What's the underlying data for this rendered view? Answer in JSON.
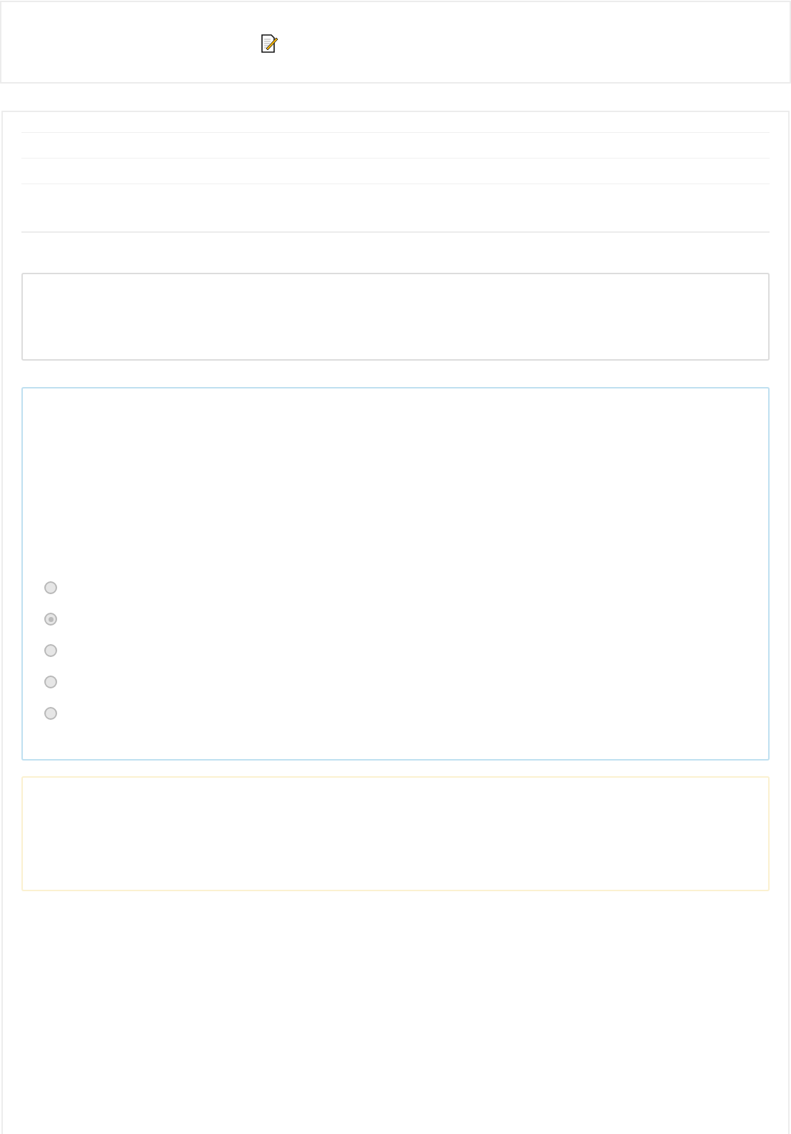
{
  "question": {
    "options": [
      {
        "selected": false
      },
      {
        "selected": true
      },
      {
        "selected": false
      },
      {
        "selected": false
      },
      {
        "selected": false
      }
    ]
  }
}
